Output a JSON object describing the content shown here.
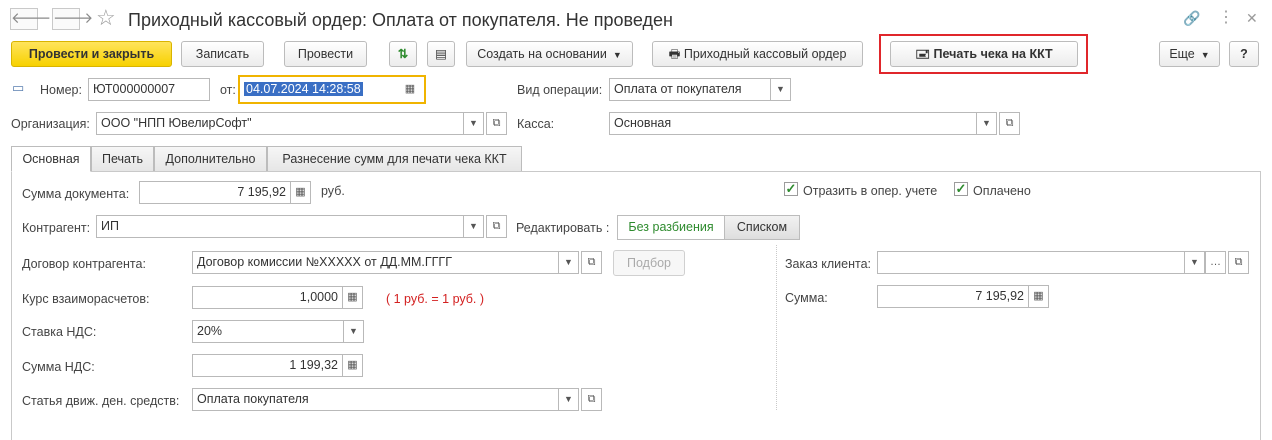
{
  "window": {
    "title": "Приходный кассовый ордер: Оплата от покупателя. Не проведен"
  },
  "toolbar": {
    "post_and_close": "Провести и закрыть",
    "save": "Записать",
    "post": "Провести",
    "create_based_on": "Создать на основании",
    "print_receipt_order": "Приходный кассовый ордер",
    "print_kkt": "Печать чека на ККТ",
    "more": "Еще",
    "help": "?"
  },
  "header": {
    "number_label": "Номер:",
    "number_value": "ЮТ000000007",
    "date_label": "от:",
    "date_value": "04.07.2024 14:28:58",
    "operation_label": "Вид операции:",
    "operation_value": "Оплата от покупателя",
    "org_label": "Организация:",
    "org_value": "ООО \"НПП ЮвелирСофт\"",
    "cash_label": "Касса:",
    "cash_value": "Основная"
  },
  "tabs": [
    "Основная",
    "Печать",
    "Дополнительно",
    "Разнесение сумм для печати чека ККТ"
  ],
  "main": {
    "doc_sum_label": "Сумма документа:",
    "doc_sum_value": "7 195,92",
    "currency": "руб.",
    "reflect_label": "Отразить в опер. учете",
    "paid_label": "Оплачено",
    "counterparty_label": "Контрагент:",
    "counterparty_value": "ИП",
    "edit_label": "Редактировать :",
    "edit_no_split": "Без разбиения",
    "edit_list": "Списком",
    "contract_label": "Договор контрагента:",
    "contract_value": "Договор комиссии №XXXXX от ДД.ММ.ГГГГ",
    "pick_button": "Подбор",
    "rate_label": "Курс взаиморасчетов:",
    "rate_value": "1,0000",
    "rate_note": "( 1 руб. = 1 руб. )",
    "vat_rate_label": "Ставка НДС:",
    "vat_rate_value": "20%",
    "vat_sum_label": "Сумма НДС:",
    "vat_sum_value": "1 199,32",
    "cashflow_label": "Статья движ. ден. средств:",
    "cashflow_value": "Оплата покупателя",
    "client_order_label": "Заказ клиента:",
    "client_order_value": "",
    "sum_label": "Сумма:",
    "sum_value": "7 195,92"
  },
  "icons": [
    "back-arrow",
    "forward-arrow",
    "star",
    "link",
    "kebab-menu",
    "close",
    "calculator",
    "calendar",
    "dropdown",
    "open-form",
    "printer",
    "cash-register"
  ],
  "colors": {
    "primary_button": "#f7d100",
    "highlight_frame": "#e0262b",
    "selection": "#3a6fc4",
    "note_red": "#d32020",
    "check_green": "#2e8b2e"
  }
}
